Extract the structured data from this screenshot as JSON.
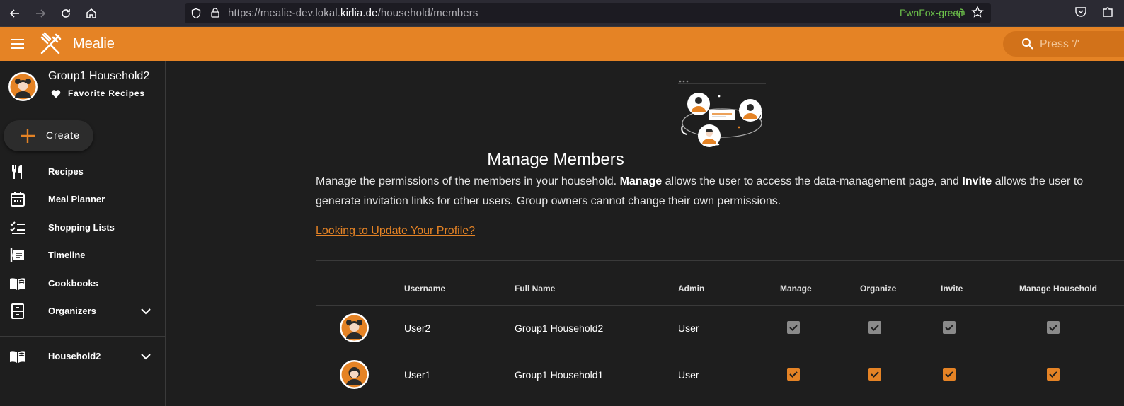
{
  "browser": {
    "url_prefix": "https://mealie-dev.lokal.",
    "url_domain": "kirlia.de",
    "url_path": "/household/members",
    "container_label": "PwnFox-green"
  },
  "header": {
    "app_title": "Mealie",
    "search_placeholder": "Press '/'",
    "accent_color": "#e58325"
  },
  "sidebar": {
    "profile_name": "Group1 Household2",
    "favorites_label": "Favorite Recipes",
    "create_label": "Create",
    "items": [
      {
        "label": "Recipes",
        "icon": "fork-knife-icon"
      },
      {
        "label": "Meal Planner",
        "icon": "calendar-icon"
      },
      {
        "label": "Shopping Lists",
        "icon": "checklist-icon"
      },
      {
        "label": "Timeline",
        "icon": "timeline-icon"
      },
      {
        "label": "Cookbooks",
        "icon": "book-open-icon"
      },
      {
        "label": "Organizers",
        "icon": "cabinet-icon"
      }
    ],
    "household_label": "Household2"
  },
  "main": {
    "title": "Manage Members",
    "desc_1": "Manage the permissions of the members in your household. ",
    "desc_manage": "Manage",
    "desc_2": " allows the user to access the data-management page, and ",
    "desc_invite": "Invite",
    "desc_3": " allows the user to generate invitation links for other users. Group owners cannot change their own permissions.",
    "profile_link": "Looking to Update Your Profile?",
    "table": {
      "headers": [
        "Username",
        "Full Name",
        "Admin",
        "Manage",
        "Organize",
        "Invite",
        "Manage Household"
      ],
      "rows": [
        {
          "username": "User2",
          "full_name": "Group1 Household2",
          "admin": "User",
          "manage": true,
          "organize": true,
          "invite": true,
          "manage_household": true,
          "locked": true
        },
        {
          "username": "User1",
          "full_name": "Group1 Household1",
          "admin": "User",
          "manage": true,
          "organize": true,
          "invite": true,
          "manage_household": true,
          "locked": false
        }
      ]
    }
  }
}
